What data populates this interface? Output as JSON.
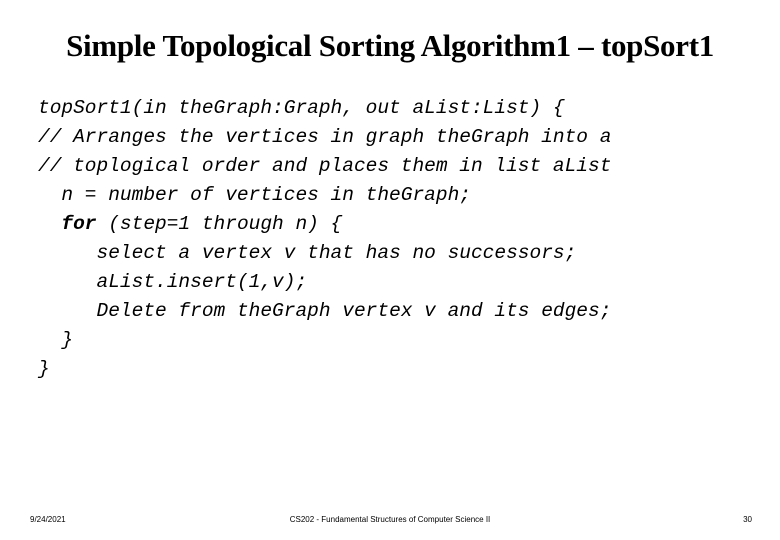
{
  "slide": {
    "title": "Simple Topological Sorting Algorithm1 – topSort1",
    "code_lines": [
      {
        "indent": "",
        "keyword": "",
        "text": "topSort1(in theGraph:Graph, out aList:List) {"
      },
      {
        "indent": "",
        "keyword": "",
        "text": "// Arranges the vertices in graph theGraph into a"
      },
      {
        "indent": "",
        "keyword": "",
        "text": "// toplogical order and places them in list aList"
      },
      {
        "indent": "  ",
        "keyword": "",
        "text": "n = number of vertices in theGraph;"
      },
      {
        "indent": "  ",
        "keyword": "for",
        "text": " (step=1 through n) {"
      },
      {
        "indent": "     ",
        "keyword": "",
        "text": "select a vertex v that has no successors;"
      },
      {
        "indent": "     ",
        "keyword": "",
        "text": "aList.insert(1,v);"
      },
      {
        "indent": "     ",
        "keyword": "",
        "text": "Delete from theGraph vertex v and its edges;"
      },
      {
        "indent": "  ",
        "keyword": "",
        "text": "}"
      },
      {
        "indent": "",
        "keyword": "",
        "text": "}"
      }
    ]
  },
  "footer": {
    "date": "9/24/2021",
    "course": "CS202 - Fundamental Structures of Computer Science II",
    "page_number": "30"
  }
}
